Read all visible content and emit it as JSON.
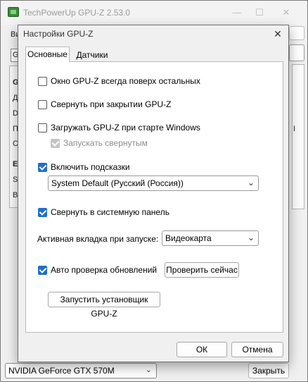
{
  "main_window": {
    "title": "TechPowerUp GPU-Z 2.53.0",
    "controls": {
      "minimize": "—",
      "maximize": "☐",
      "close": "✕"
    },
    "fragments": {
      "menu": "Ви",
      "device_combo": "Ge",
      "group1": "G",
      "row1": "Д",
      "row2": "D",
      "row3": "П",
      "row4": "С/",
      "group2": "E(",
      "row5": "Su",
      "row6": "Ви",
      "right_row": "I"
    },
    "gpu_select": {
      "value": "NVIDIA GeForce GTX 570M",
      "arrow": "⌄"
    },
    "close_button": "Закрыть"
  },
  "dialog": {
    "title": "Настройки GPU-Z",
    "close": "✕",
    "tabs": [
      {
        "label": "Основные",
        "active": true
      },
      {
        "label": "Датчики",
        "active": false
      }
    ],
    "options": {
      "always_on_top": {
        "label": "Окно GPU-Z всегда поверх остальных",
        "checked": false
      },
      "minimize_on_close": {
        "label": "Свернуть при закрытии GPU-Z",
        "checked": false
      },
      "load_on_startup": {
        "label": "Загружать GPU-Z при старте Windows",
        "checked": false
      },
      "start_minimized": {
        "label": "Запускать свернутым",
        "checked": true,
        "disabled": true
      },
      "enable_tooltips": {
        "label": "Включить подсказки",
        "checked": true
      },
      "minimize_to_tray": {
        "label": "Свернуть в системную панель",
        "checked": true
      },
      "auto_update": {
        "label": "Авто проверка обновлений",
        "checked": true
      }
    },
    "language_select": {
      "value": "System Default (Русский (Россия))",
      "arrow": "⌄"
    },
    "startup_tab": {
      "label": "Активная вкладка при запуске:",
      "value": "Видеокарта",
      "arrow": "⌄"
    },
    "check_now_button": "Проверить сейчас",
    "run_installer_button": "Запустить установщик GPU-Z",
    "ok_button": "ОК",
    "cancel_button": "Отмена"
  }
}
